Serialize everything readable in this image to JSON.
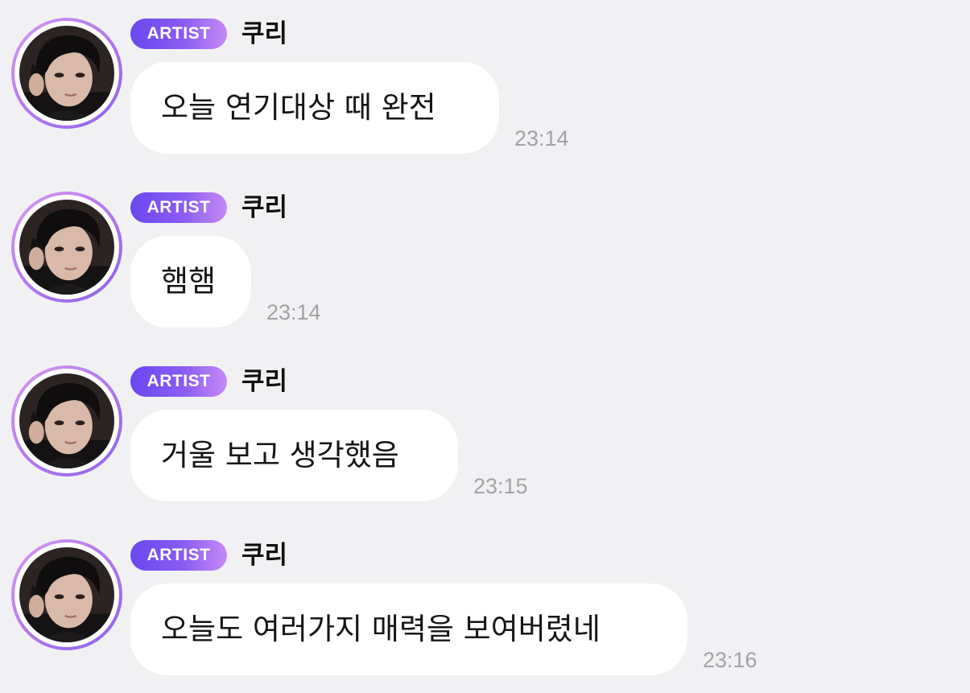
{
  "chat": {
    "messages": [
      {
        "badge": "ARTIST",
        "sender": "쿠리",
        "text": "오늘 연기대상 때 완전",
        "time": "23:14"
      },
      {
        "badge": "ARTIST",
        "sender": "쿠리",
        "text": "햄햄",
        "time": "23:14"
      },
      {
        "badge": "ARTIST",
        "sender": "쿠리",
        "text": "거울 보고 생각했음",
        "time": "23:15"
      },
      {
        "badge": "ARTIST",
        "sender": "쿠리",
        "text": "오늘도 여러가지 매력을 보여버렸네",
        "time": "23:16"
      }
    ]
  },
  "colors": {
    "background": "#f1f1f3",
    "bubble": "#ffffff",
    "badge_start": "#6a47f0",
    "badge_end": "#c58af5",
    "avatar_ring": "#b77aef",
    "timestamp": "#a3a3a6"
  },
  "icons": {
    "avatar": "artist-profile-photo"
  }
}
